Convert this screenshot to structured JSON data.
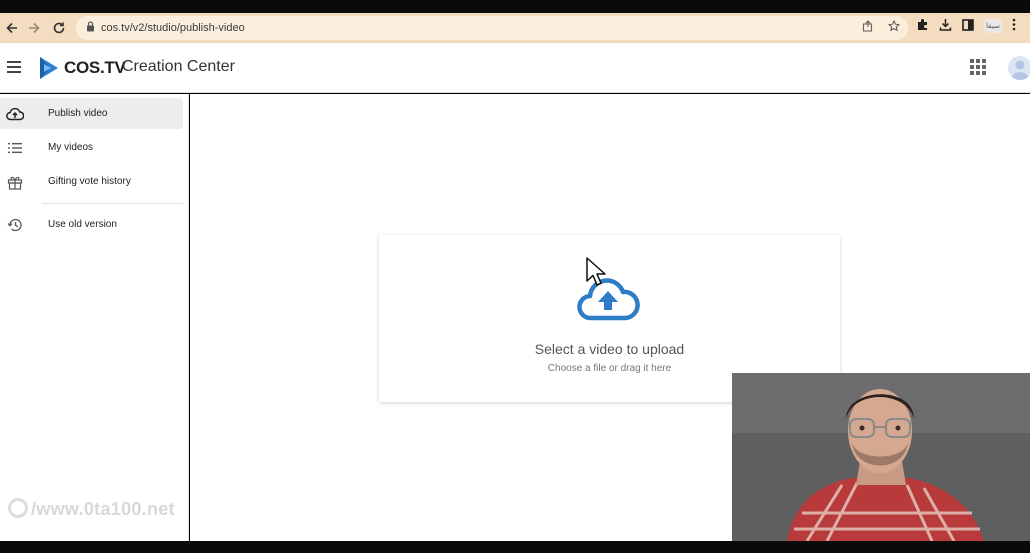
{
  "browser": {
    "url": "cos.tv/v2/studio/publish-video",
    "profile_chip": "سيفا"
  },
  "header": {
    "brand": "COS.TV",
    "subtitle": "Creation Center"
  },
  "sidebar": {
    "items": [
      {
        "label": "Publish video",
        "icon": "cloud-upload-icon",
        "active": true
      },
      {
        "label": "My videos",
        "icon": "list-icon",
        "active": false
      },
      {
        "label": "Gifting vote history",
        "icon": "gift-icon",
        "active": false
      },
      {
        "label": "Use old version",
        "icon": "history-icon",
        "active": false
      }
    ]
  },
  "upload": {
    "title": "Select a video to upload",
    "subtitle": "Choose a file or drag it here"
  },
  "watermark": "/www.0ta100.net",
  "colors": {
    "chrome_bg": "#f3dcc0",
    "accent_blue": "#2e7bc6",
    "active_item_bg": "#ededed"
  }
}
